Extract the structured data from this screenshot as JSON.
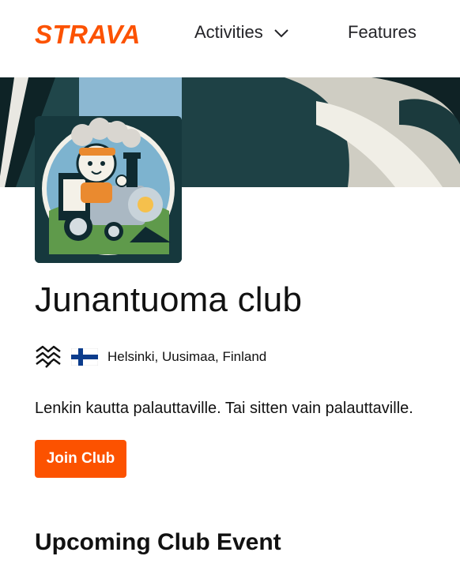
{
  "header": {
    "logo_text": "STRAVA",
    "nav": {
      "activities_label": "Activities",
      "features_label": "Features"
    }
  },
  "club": {
    "name": "Junantuoma club",
    "sport_icon": "run-wave-icon",
    "country_flag": "finland-flag-icon",
    "location": "Helsinki, Uusimaa, Finland",
    "description": "Lenkin kautta palauttaville. Tai sitten vain palauttaville.",
    "join_label": "Join Club"
  },
  "sections": {
    "upcoming_title": "Upcoming Club Event"
  },
  "colors": {
    "brand": "#fc5200",
    "text": "#111111"
  }
}
